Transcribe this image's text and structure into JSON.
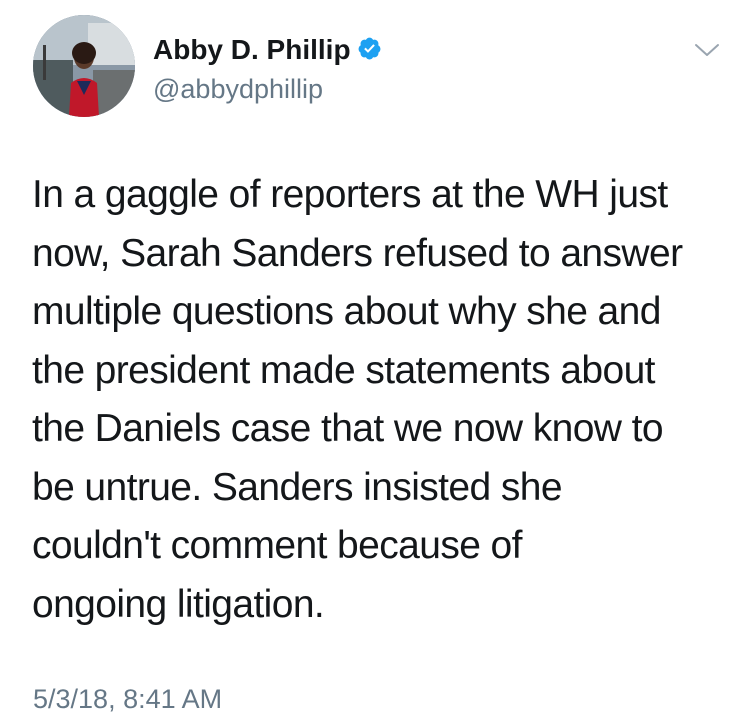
{
  "author": {
    "display_name": "Abby D. Phillip",
    "handle": "@abbydphillip",
    "verified": true
  },
  "icons": {
    "verified": "verified-badge-icon",
    "menu": "chevron-down-icon"
  },
  "tweet": {
    "lines": [
      "In a gaggle of reporters at the WH just",
      "now, Sarah Sanders refused to answer",
      "multiple questions about why she and",
      "the president made statements about",
      "the Daniels case that we now know to",
      "be untrue. Sanders insisted she",
      "couldn't comment because of",
      "ongoing litigation."
    ],
    "timestamp": "5/3/18, 8:41 AM"
  },
  "colors": {
    "text": "#14171a",
    "secondary": "#657786",
    "verified_blue": "#1da1f2",
    "background": "#ffffff"
  }
}
